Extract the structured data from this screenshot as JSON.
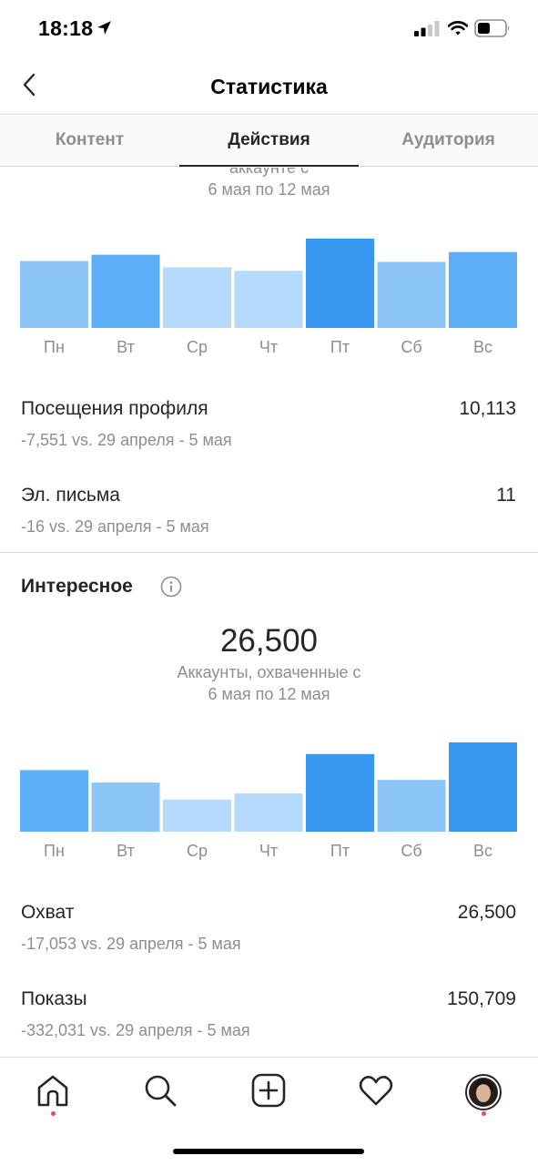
{
  "status_bar": {
    "time": "18:18"
  },
  "header": {
    "title": "Статистика"
  },
  "tabs": [
    {
      "label": "Контент"
    },
    {
      "label": "Действия"
    },
    {
      "label": "Аудитория"
    }
  ],
  "actions_section": {
    "caption_lines": [
      "аккаунте с",
      "6 мая по 12 мая"
    ],
    "chart_data": {
      "type": "bar",
      "categories": [
        "Пн",
        "Вт",
        "Ср",
        "Чт",
        "Пт",
        "Сб",
        "Вс"
      ],
      "values": [
        0.75,
        0.82,
        0.68,
        0.64,
        1.0,
        0.74,
        0.85
      ],
      "colors": [
        "#8cc5f8",
        "#5eb0f6",
        "#b6dafb",
        "#b6dafb",
        "#3897f0",
        "#8cc5f8",
        "#5eb0f6"
      ]
    },
    "metrics": [
      {
        "label": "Посещения профиля",
        "value": "10,113",
        "delta": "-7,551 vs. 29 апреля - 5 мая"
      },
      {
        "label": "Эл. письма",
        "value": "11",
        "delta": "-16 vs. 29 апреля - 5 мая"
      }
    ]
  },
  "discovery_section": {
    "title": "Интересное",
    "big_number": "26,500",
    "caption_lines": [
      "Аккаунты, охваченные с",
      "6 мая по 12 мая"
    ],
    "chart_data": {
      "type": "bar",
      "categories": [
        "Пн",
        "Вт",
        "Ср",
        "Чт",
        "Пт",
        "Сб",
        "Вс"
      ],
      "values": [
        0.69,
        0.55,
        0.36,
        0.43,
        0.87,
        0.58,
        1.0
      ],
      "colors": [
        "#5eb0f6",
        "#8cc5f8",
        "#b6dafb",
        "#b6dafb",
        "#3897f0",
        "#8cc5f8",
        "#3897f0"
      ]
    },
    "metrics": [
      {
        "label": "Охват",
        "value": "26,500",
        "delta": "-17,053 vs. 29 апреля - 5 мая"
      },
      {
        "label": "Показы",
        "value": "150,709",
        "delta": "-332,031 vs. 29 апреля - 5 мая"
      }
    ]
  },
  "bottom_nav": {
    "items": [
      "home-icon",
      "search-icon",
      "new-post-icon",
      "activity-heart-icon",
      "profile-avatar"
    ],
    "notification_color": "#ed4956"
  }
}
